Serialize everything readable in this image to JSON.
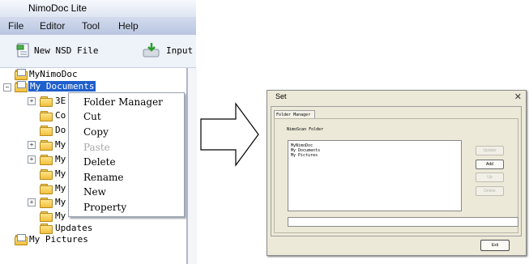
{
  "app": {
    "title": "NimoDoc Lite",
    "menu": [
      "File",
      "Editor",
      "Tool",
      "Help"
    ],
    "toolbar": {
      "new_label": "New NSD File",
      "input_label": "Input"
    }
  },
  "tree": {
    "root_item": "MyNimoDoc",
    "selected_item": "My Documents",
    "children": [
      "3E",
      "Co",
      "Do",
      "My",
      "My",
      "My",
      "My",
      "My",
      "My",
      "Updates"
    ],
    "last_item": "My Pictures"
  },
  "context_menu": {
    "items": [
      {
        "label": "Folder Manager",
        "enabled": true
      },
      {
        "label": "Cut",
        "enabled": true
      },
      {
        "label": "Copy",
        "enabled": true
      },
      {
        "label": "Paste",
        "enabled": false
      },
      {
        "label": "Delete",
        "enabled": true
      },
      {
        "label": "Rename",
        "enabled": true
      },
      {
        "label": "New",
        "enabled": true
      },
      {
        "label": "Property",
        "enabled": true
      }
    ]
  },
  "dialog": {
    "title": "Set",
    "close_glyph": "✕",
    "tab": "Folder Manager",
    "group_label": "NimoScan Folder",
    "folders": [
      "MyNimoDoc",
      "My Documents",
      "My Pictures"
    ],
    "buttons": [
      {
        "label": "Update",
        "enabled": false
      },
      {
        "label": "Add",
        "enabled": true
      },
      {
        "label": "Up",
        "enabled": false
      },
      {
        "label": "Delete",
        "enabled": false
      }
    ],
    "path_value": "",
    "exit_label": "Exit"
  },
  "icons": {
    "new_file": "new-file-icon",
    "input": "input-icon",
    "folder": "folder-icon",
    "arrow": "right-arrow-icon"
  },
  "colors": {
    "selection": "#1f5fcc",
    "menu_bar": "#c6d0e6",
    "dialog_bg": "#ece9d8"
  }
}
